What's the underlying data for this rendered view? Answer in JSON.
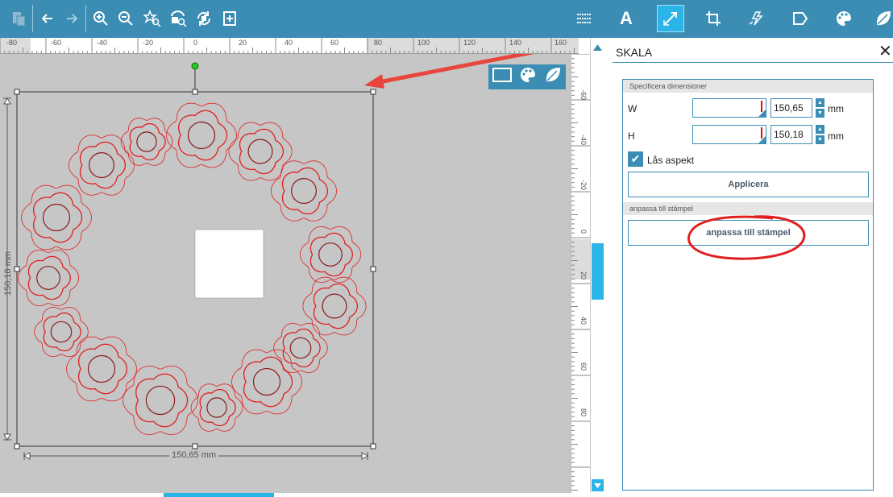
{
  "toolbar": {
    "left_icons": [
      "paste-icon",
      "undo-icon",
      "redo-icon",
      "zoom-in-icon",
      "zoom-out-icon",
      "zoom-selection-icon",
      "zoom-fit-icon",
      "zoom-pan-icon",
      "fit-page-icon"
    ],
    "right_icons": [
      "align-lines-icon",
      "text-icon",
      "scale-icon",
      "crop-icon",
      "trace-icon",
      "page-setup-icon",
      "color-palette-icon",
      "leaf-icon"
    ],
    "active_tool": "scale-icon",
    "text_tool_glyph": "A"
  },
  "ruler_top": {
    "ticks": [
      "-80",
      "-60",
      "-40",
      "-20",
      "0",
      "20",
      "40",
      "60",
      "80",
      "100",
      "120",
      "140",
      "160"
    ]
  },
  "ruler_side": {
    "ticks": [
      "-60",
      "-40",
      "-20",
      "0",
      "20",
      "40",
      "60",
      "80"
    ]
  },
  "canvas": {
    "height_label": "150,18 mm",
    "width_label": "150,65 mm",
    "mini_toolbar_icons": [
      "rectangle-icon",
      "palette-icon",
      "leaf-icon"
    ]
  },
  "panel": {
    "title": "SKALA",
    "section_dimensions": "Specificera dimensioner",
    "w_label": "W",
    "w_value": "150,65",
    "h_label": "H",
    "h_value": "150,18",
    "unit": "mm",
    "lock_aspect_label": "Lås aspekt",
    "lock_aspect_checked": true,
    "apply_button": "Applicera",
    "section_fit": "anpassa till stämpel",
    "fit_button": "anpassa till stämpel"
  },
  "colors": {
    "toolbar": "#3c8db4",
    "canvas": "#c6c6c6",
    "cut_line": "#e02020",
    "annotation": "#e8463c"
  }
}
